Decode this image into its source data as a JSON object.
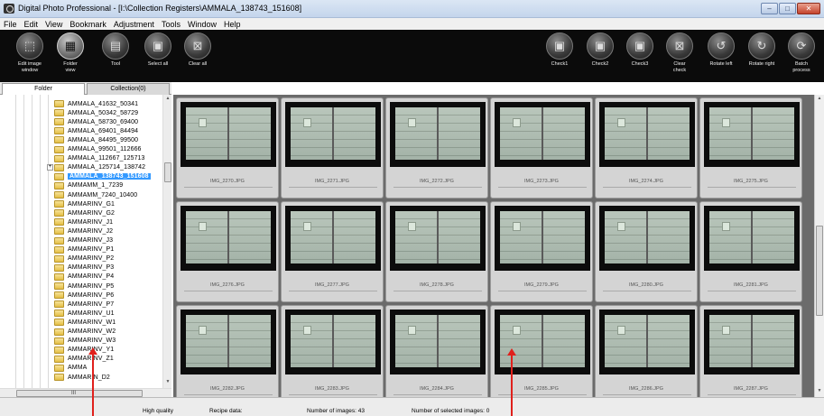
{
  "window": {
    "title": "Digital Photo Professional - [I:\\Collection Registers\\AMMALA_138743_151608]",
    "minimize": "–",
    "maximize": "□",
    "close": "✕"
  },
  "menu": [
    "File",
    "Edit",
    "View",
    "Bookmark",
    "Adjustment",
    "Tools",
    "Window",
    "Help"
  ],
  "toolbar": {
    "left": [
      {
        "label": "Edit image\nwindow",
        "icon": "edit-image-icon",
        "glyph": "⬚"
      },
      {
        "label": "Folder\nview",
        "icon": "folder-view-icon",
        "glyph": "▦",
        "active": true
      },
      {
        "label": "Tool",
        "icon": "tool-icon",
        "glyph": "▤"
      },
      {
        "label": "Select all",
        "icon": "select-all-icon",
        "glyph": "▣"
      },
      {
        "label": "Clear all",
        "icon": "clear-all-icon",
        "glyph": "⊠"
      }
    ],
    "right": [
      {
        "label": "Check1",
        "icon": "check1-icon",
        "glyph": "▣"
      },
      {
        "label": "Check2",
        "icon": "check2-icon",
        "glyph": "▣"
      },
      {
        "label": "Check3",
        "icon": "check3-icon",
        "glyph": "▣"
      },
      {
        "label": "Clear\ncheck",
        "icon": "clear-check-icon",
        "glyph": "⊠"
      },
      {
        "label": "Rotate left",
        "icon": "rotate-left-icon",
        "glyph": "↺"
      },
      {
        "label": "Rotate right",
        "icon": "rotate-right-icon",
        "glyph": "↻"
      },
      {
        "label": "Batch\nprocess",
        "icon": "batch-process-icon",
        "glyph": "⟳"
      }
    ]
  },
  "tabs": {
    "folder": "Folder",
    "collection": "Collection(0)"
  },
  "tree": {
    "items": [
      "AMMALA_41632_50341",
      "AMMALA_50342_58729",
      "AMMALA_58730_69400",
      "AMMALA_69401_84494",
      "AMMALA_84495_99500",
      "AMMALA_99501_112666",
      "AMMALA_112667_125713",
      "AMMALA_125714_138742",
      "AMMALA_138743_151608",
      "AMMAMM_1_7239",
      "AMMAMM_7240_10400",
      "AMMARINV_G1",
      "AMMARINV_G2",
      "AMMARINV_J1",
      "AMMARINV_J2",
      "AMMARINV_J3",
      "AMMARINV_P1",
      "AMMARINV_P2",
      "AMMARINV_P3",
      "AMMARINV_P4",
      "AMMARINV_P5",
      "AMMARINV_P6",
      "AMMARINV_P7",
      "AMMARINV_U1",
      "AMMARINV_W1",
      "AMMARINV_W2",
      "AMMARINV_W3",
      "AMMARINV_Y1",
      "AMMARINV_Z1",
      "AMMA",
      "AMMARIN_D2"
    ],
    "selected_index": 8,
    "expander_glyph": "+",
    "hscroll_label": "III"
  },
  "thumbnails": [
    "IMG_2270.JPG",
    "IMG_2271.JPG",
    "IMG_2272.JPG",
    "IMG_2273.JPG",
    "IMG_2274.JPG",
    "IMG_2275.JPG",
    "IMG_2276.JPG",
    "IMG_2277.JPG",
    "IMG_2278.JPG",
    "IMG_2279.JPG",
    "IMG_2280.JPG",
    "IMG_2281.JPG",
    "IMG_2282.JPG",
    "IMG_2283.JPG",
    "IMG_2284.JPG",
    "IMG_2285.JPG",
    "IMG_2286.JPG",
    "IMG_2287.JPG"
  ],
  "status": {
    "quality": "High quality",
    "recipe": "Recipe data:",
    "images": "Number of images: 43",
    "selected": "Number of selected images: 0"
  },
  "colors": {
    "toolbar_bg": "#0b0b0b",
    "grid_bg": "#6b6b6b",
    "selection": "#3399ff",
    "annotation_arrow": "#e0201c"
  }
}
